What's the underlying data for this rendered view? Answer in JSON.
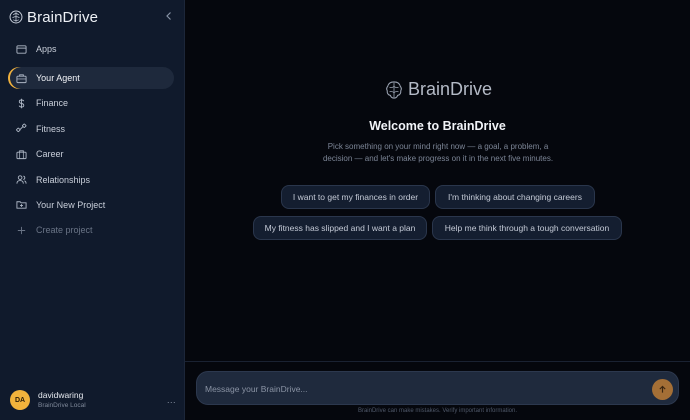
{
  "app": {
    "name": "BrainDrive"
  },
  "sidebar": {
    "items": [
      {
        "label": "Apps",
        "icon": "window-icon"
      },
      {
        "label": "Your Agent",
        "icon": "briefcase-icon",
        "active": true
      },
      {
        "label": "Finance",
        "icon": "dollar-icon"
      },
      {
        "label": "Fitness",
        "icon": "dumbbell-icon"
      },
      {
        "label": "Career",
        "icon": "briefcase-icon"
      },
      {
        "label": "Relationships",
        "icon": "users-icon"
      },
      {
        "label": "Your New Project",
        "icon": "folder-plus-icon"
      },
      {
        "label": "Create project",
        "icon": "plus-icon"
      }
    ],
    "user": {
      "initials": "DA",
      "name": "davidwaring",
      "subtitle": "BrainDrive Local",
      "more": "..."
    }
  },
  "main": {
    "brand": "BrainDrive",
    "welcome": "Welcome to BrainDrive",
    "intro": "Pick something on your mind right now — a goal, a problem, a decision — and let's make progress on it in the next five minutes.",
    "suggestions": [
      "I want to get my finances in order",
      "I'm thinking about changing careers",
      "My fitness has slipped and I want a plan",
      "Help me think through a tough conversation"
    ],
    "composer": {
      "placeholder": "Message your BrainDrive..."
    },
    "disclaimer": "BrainDrive can make mistakes. Verify important information."
  },
  "colors": {
    "accent": "#f2b33c",
    "sidebar_bg": "#101a2c",
    "main_bg": "#05070d",
    "send_button": "#a46f36"
  }
}
